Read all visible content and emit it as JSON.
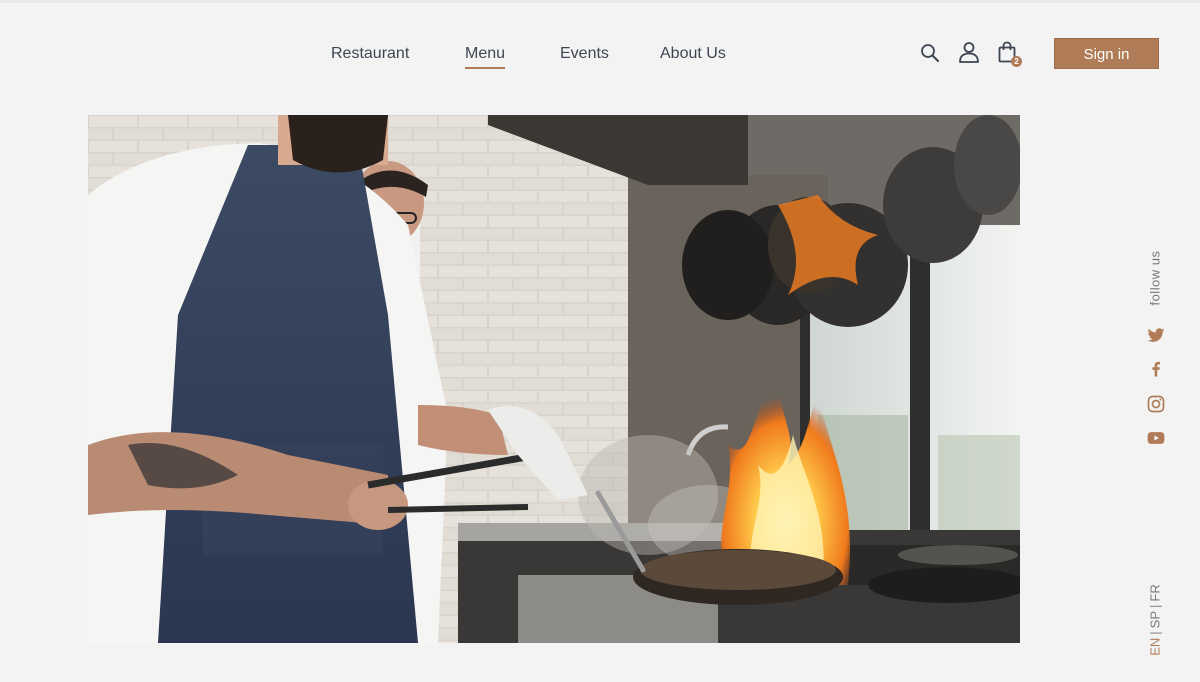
{
  "nav": {
    "items": [
      {
        "label": "Restaurant",
        "active": false
      },
      {
        "label": "Menu",
        "active": true
      },
      {
        "label": "Events",
        "active": false
      },
      {
        "label": "About Us",
        "active": false
      }
    ]
  },
  "header": {
    "icons": [
      "search-icon",
      "user-icon",
      "shopping-bag-icon"
    ],
    "cart_count": "2",
    "signin_label": "Sign in"
  },
  "hero": {
    "image_subject": "chef flambéing a pan in a commercial kitchen"
  },
  "sidebar": {
    "follow_label": "follow us",
    "social": [
      "twitter-icon",
      "facebook-icon",
      "instagram-icon",
      "youtube-icon"
    ],
    "languages": [
      {
        "code": "EN",
        "active": true
      },
      {
        "code": "SP",
        "active": false
      },
      {
        "code": "FR",
        "active": false
      }
    ]
  },
  "colors": {
    "accent": "#b07b57",
    "background": "#f3f3f3",
    "nav_text": "#3e4652"
  }
}
